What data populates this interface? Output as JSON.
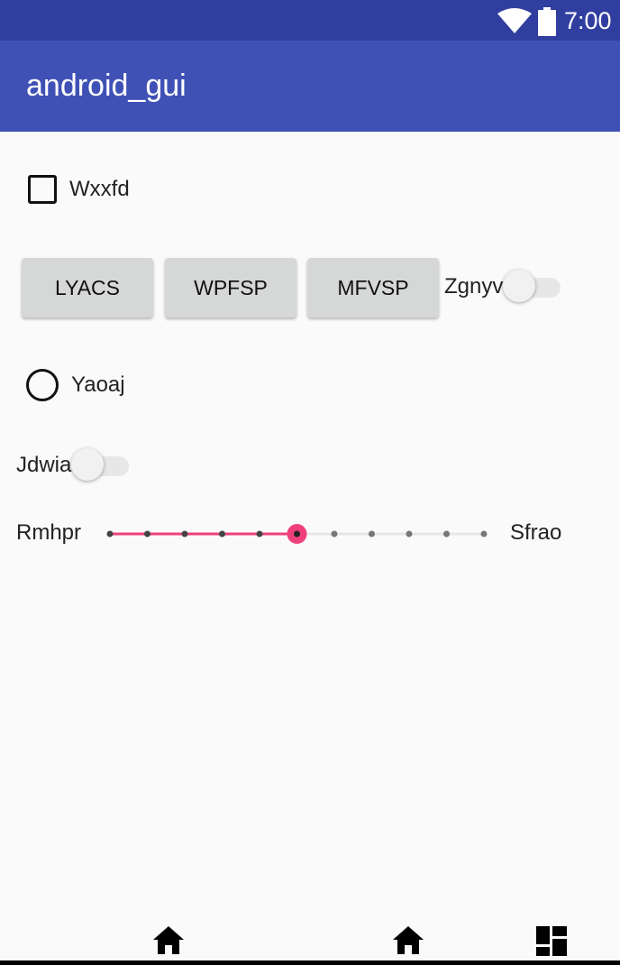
{
  "status_bar": {
    "time": "7:00",
    "icons": [
      "wifi-icon",
      "battery-icon"
    ],
    "background": "#303f9f"
  },
  "app_bar": {
    "title": "android_gui",
    "background": "#3f51b5"
  },
  "checkbox": {
    "label": "Wxxfd",
    "checked": false
  },
  "buttons": [
    {
      "label": "LYACS"
    },
    {
      "label": "WPFSP"
    },
    {
      "label": "MFVSP"
    }
  ],
  "switch_1": {
    "label": "Zgnyv",
    "on": false
  },
  "radio": {
    "label": "Yaoaj",
    "selected": false
  },
  "switch_2": {
    "label": "Jdwia",
    "on": false
  },
  "seekbar": {
    "min_label": "Rmhpr",
    "max_label": "Sfrao",
    "steps": 10,
    "value": 5,
    "accent": "#f0407a"
  },
  "nav_bar": {
    "icons": [
      "home-icon",
      "home-icon",
      "recents-icon"
    ]
  }
}
